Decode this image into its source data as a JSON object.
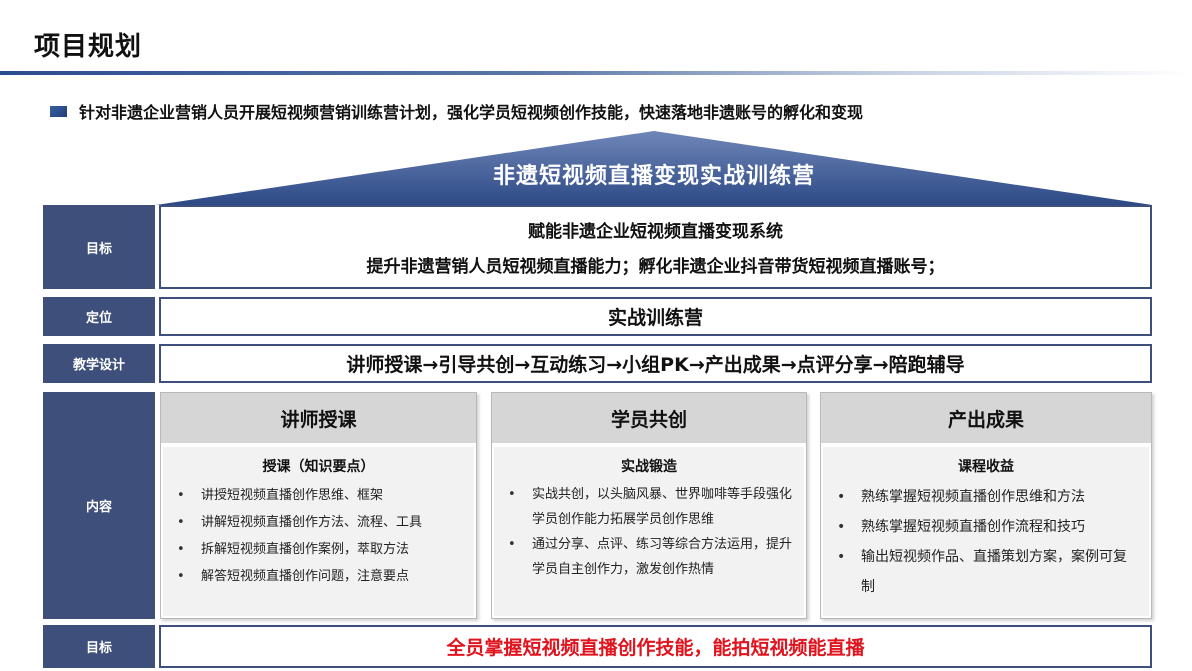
{
  "page": {
    "title": "项目规划",
    "intro": "针对非遗企业营销人员开展短视频营销训练营计划，强化学员短视频创作技能，快速落地非遗账号的孵化和变现"
  },
  "roof": {
    "title": "非遗短视频直播变现实战训练营"
  },
  "rows": {
    "goal": {
      "label": "目标",
      "line1": "赋能非遗企业短视频直播变现系统",
      "line2": "提升非遗营销人员短视频直播能力；孵化非遗企业抖音带货短视频直播账号；"
    },
    "position": {
      "label": "定位",
      "text": "实战训练营"
    },
    "design": {
      "label": "教学设计",
      "text": "讲师授课→引导共创→互动练习→小组PK→产出成果→点评分享→陪跑辅导"
    },
    "content": {
      "label": "内容"
    },
    "final_goal": {
      "label": "目标",
      "text": "全员掌握短视频直播创作技能，能拍短视频能直播"
    }
  },
  "panels": [
    {
      "head": "讲师授课",
      "sub": "授课（知识要点）",
      "items": [
        "讲授短视频直播创作思维、框架",
        "讲解短视频直播创作方法、流程、工具",
        "拆解短视频直播创作案例，萃取方法",
        "解答短视频直播创作问题，注意要点"
      ]
    },
    {
      "head": "学员共创",
      "sub": "实战锻造",
      "items": [
        "实战共创，以头脑风暴、世界咖啡等手段强化学员创作能力拓展学员创作思维",
        "通过分享、点评、练习等综合方法运用，提升学员自主创作力，激发创作热情"
      ]
    },
    {
      "head": "产出成果",
      "sub": "课程收益",
      "items": [
        "熟练掌握短视频直播创作思维和方法",
        "熟练掌握短视频直播创作流程和技巧",
        "输出短视频作品、直播策划方案，案例可复制"
      ]
    }
  ],
  "colors": {
    "label_bg": "#3d4f7a",
    "accent_blue": "#2a4d8f",
    "highlight_red": "#e0141e"
  }
}
